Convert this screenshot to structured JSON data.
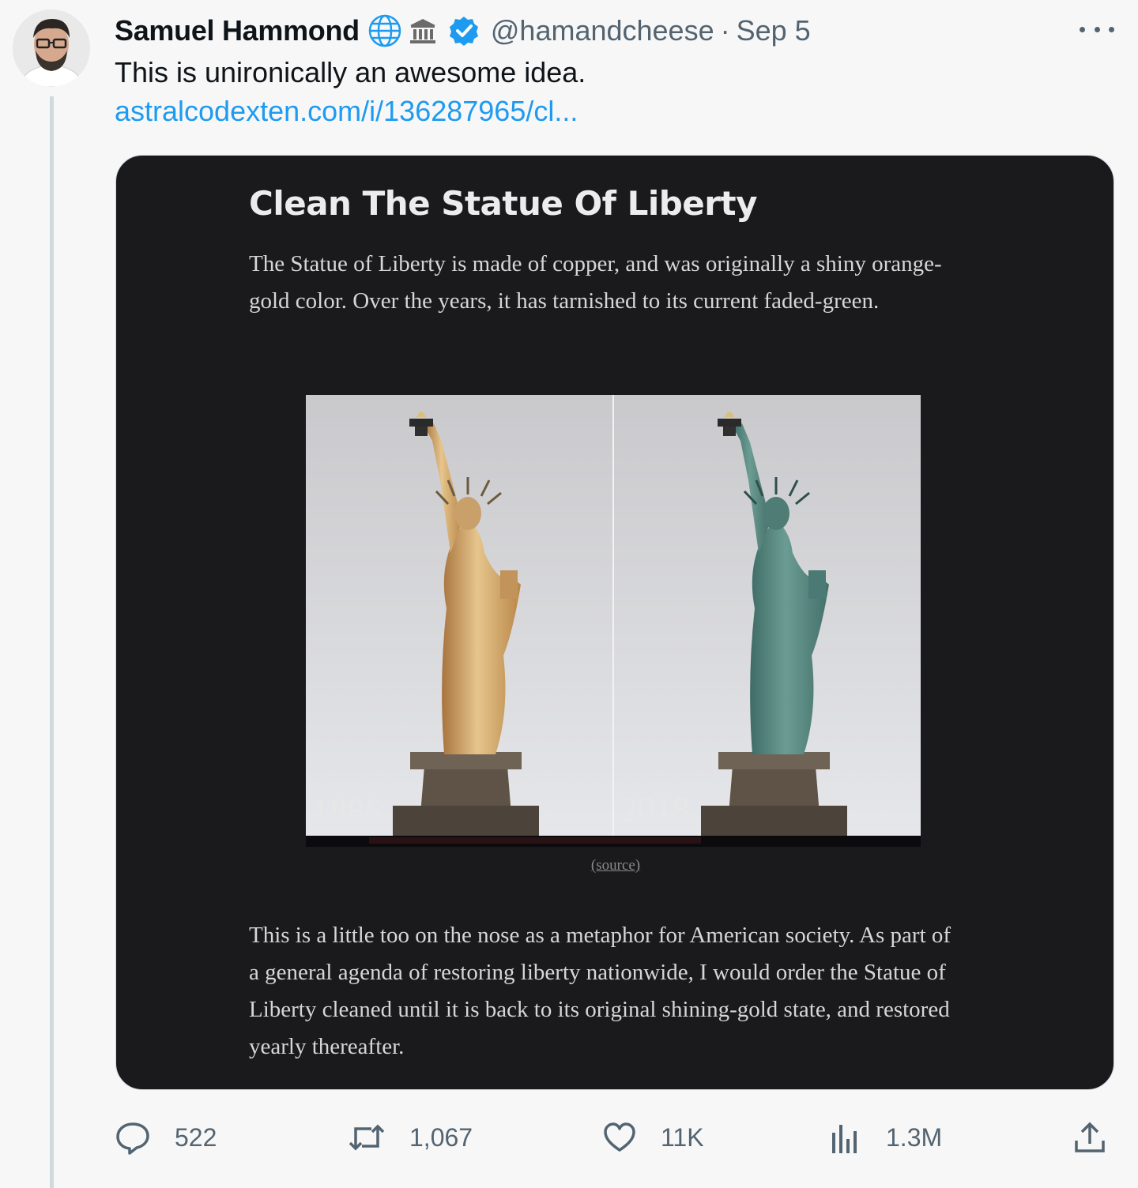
{
  "tweet": {
    "author_name": "Samuel Hammond",
    "handle": "@hamandcheese",
    "separator": "·",
    "date": "Sep 5",
    "text": "This is unironically an awesome idea.",
    "link": "astralcodexten.com/i/136287965/cl..."
  },
  "card": {
    "title": "Clean The Statue Of Liberty",
    "paragraph1": "The Statue of Liberty is made of copper, and was originally a shiny orange-gold color. Over the years, it has tarnished to its current faded-green.",
    "image_label_left": "1886",
    "image_label_right": "2018",
    "caption": "(source)",
    "paragraph2": "This is a little too on the nose as a metaphor for American society. As part of a general agenda of restoring liberty nationwide, I would order the Statue of Liberty cleaned until it is back to its original shining-gold state, and restored yearly thereafter."
  },
  "actions": {
    "replies": "522",
    "retweets": "1,067",
    "likes": "11K",
    "views": "1.3M"
  },
  "icons": [
    "globe-icon",
    "bank-icon",
    "verified-icon",
    "more-icon",
    "reply-icon",
    "retweet-icon",
    "like-icon",
    "views-icon",
    "share-icon"
  ],
  "colors": {
    "link": "#1d9bf0",
    "verified": "#1d9bf0",
    "muted": "#536471",
    "card_bg": "#1a1a1d"
  }
}
